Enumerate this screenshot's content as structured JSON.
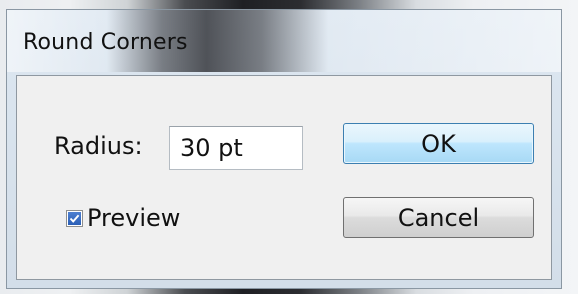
{
  "dialog": {
    "title": "Round Corners",
    "radius_label": "Radius:",
    "radius_value": "30 pt",
    "preview_label": "Preview",
    "preview_checked": true,
    "ok_label": "OK",
    "cancel_label": "Cancel"
  },
  "colors": {
    "accent_button_border": "#3c7fb1",
    "checkbox_fill": "#2b5fb6"
  }
}
